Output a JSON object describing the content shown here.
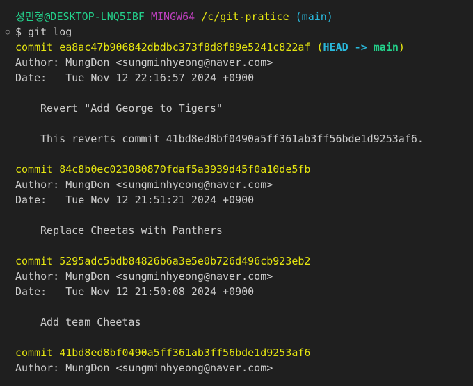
{
  "prompt": {
    "user": "성민형",
    "host": "@DESKTOP-LNQ5IBF",
    "env": "MINGW64",
    "path": "/c/git-pratice",
    "branch": "(main)",
    "command": "$ git log"
  },
  "commits": [
    {
      "commit_label": "commit ea8ac47b906842dbdbc373f8d8f89e5241c822af",
      "ref_open": "(",
      "head": "HEAD -> ",
      "main": "main",
      "ref_close": ")",
      "author": "Author: MungDon <sungminhyeong@naver.com>",
      "date": "Date:   Tue Nov 12 22:16:57 2024 +0900",
      "message_lines": [
        "Revert \"Add George to Tigers\"",
        "This reverts commit 41bd8ed8bf0490a5ff361ab3ff56bde1d9253af6."
      ]
    },
    {
      "commit_label": "commit 84c8b0ec023080870fdaf5a3939d45f0a10de5fb",
      "author": "Author: MungDon <sungminhyeong@naver.com>",
      "date": "Date:   Tue Nov 12 21:51:21 2024 +0900",
      "message_lines": [
        "Replace Cheetas with Panthers"
      ]
    },
    {
      "commit_label": "commit 5295adc5bdb84826b6a3e5e0b726d496cb923eb2",
      "author": "Author: MungDon <sungminhyeong@naver.com>",
      "date": "Date:   Tue Nov 12 21:50:08 2024 +0900",
      "message_lines": [
        "Add team Cheetas"
      ]
    },
    {
      "commit_label": "commit 41bd8ed8bf0490a5ff361ab3ff56bde1d9253af6",
      "author": "Author: MungDon <sungminhyeong@naver.com>"
    }
  ],
  "colors": {
    "background": "#1f1f1f",
    "text": "#cccccc",
    "green": "#23d18b",
    "magenta": "#bc3fbc",
    "yellow": "#e5e510",
    "cyan": "#29b8db"
  },
  "icons": {
    "prompt_marker": "circle-outline-icon"
  }
}
